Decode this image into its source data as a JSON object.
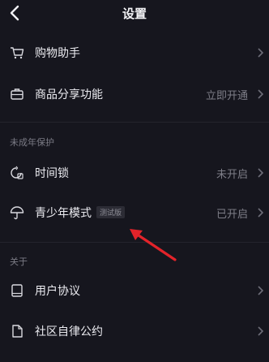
{
  "header": {
    "title": "设置",
    "back_icon": "chevron-left-icon"
  },
  "rows": {
    "shopping": {
      "label": "购物助手",
      "icon": "cart-icon"
    },
    "share": {
      "label": "商品分享功能",
      "value": "立即开通",
      "icon": "briefcase-icon"
    },
    "time_lock": {
      "label": "时间锁",
      "value": "未开启",
      "icon": "timer-lock-icon"
    },
    "teen_mode": {
      "label": "青少年模式",
      "tag": "测试版",
      "value": "已开启",
      "icon": "umbrella-icon"
    },
    "user_agreement": {
      "label": "用户协议",
      "icon": "book-icon"
    },
    "community": {
      "label": "社区自律公约",
      "icon": "document-icon"
    }
  },
  "sections": {
    "minor_protection": "未成年保护",
    "about": "关于"
  },
  "colors": {
    "background": "#16161e",
    "annotation_arrow": "#e3232a"
  }
}
